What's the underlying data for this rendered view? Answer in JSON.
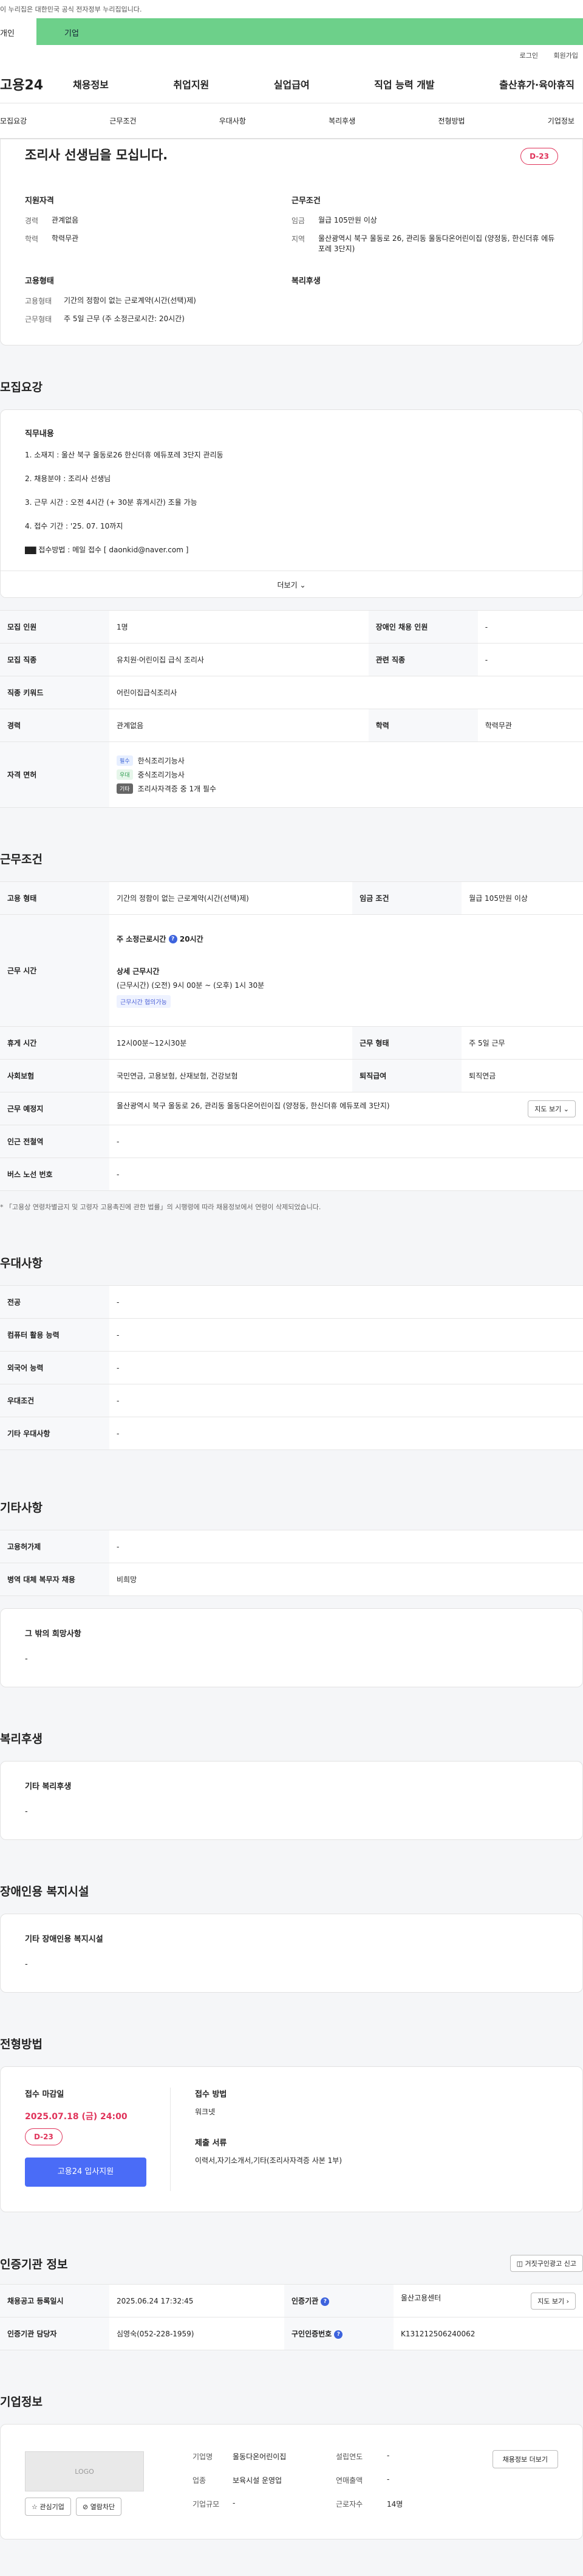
{
  "gov_notice": "이 누리집은 대한민국 공식 전자정부 누리집입니다.",
  "tabs": {
    "person": "개인",
    "company": "기업"
  },
  "util": {
    "login": "로그인",
    "join": "회원가입"
  },
  "logo": "고용24",
  "gnb": [
    "채용정보",
    "취업지원",
    "실업급여",
    "직업 능력 개발",
    "출산휴가·육아휴직"
  ],
  "anchor_nav": [
    "모집요강",
    "근무조건",
    "우대사항",
    "복리후생",
    "전형방법",
    "기업정보"
  ],
  "headline": {
    "title": "조리사 선생님을 모십니다.",
    "dday": "D-23",
    "qual_title": "지원자격",
    "qual": [
      {
        "k": "경력",
        "v": "관계없음"
      },
      {
        "k": "학력",
        "v": "학력무관"
      }
    ],
    "cond_title": "근무조건",
    "cond": [
      {
        "k": "임금",
        "v": "월급 105만원 이상"
      },
      {
        "k": "지역",
        "v": "울산광역시 북구 울동로 26, 관리동 울동다온어린이집 (양정동, 한신더휴 에듀포레 3단지)"
      }
    ],
    "employ_title": "고용형태",
    "employ": [
      {
        "k": "고용형태",
        "v": "기간의 정함이 없는 근로계약(시간(선택)제)"
      },
      {
        "k": "근무형태",
        "v": "주 5일 근무 (주 소정근로시간: 20시간)"
      }
    ],
    "welfare_title": "복리후생"
  },
  "recruit": {
    "section": "모집요강",
    "duty_title": "직무내용",
    "duty_lines": [
      "1. 소재지 : 울산 북구 울동로26 한신더휴 에듀포레 3단지 관리동",
      "2. 채용분야 : 조리사 선생님",
      "3. 근무 시간 : 오전 4시간 (+ 30분 휴게시간) 조율 가능",
      "4. 접수 기간 : '25. 07. 10까지",
      "▇▇ 접수방법 : 메일 접수 [ daonkid@naver.com ]"
    ],
    "more": "더보기",
    "rows": {
      "headcount_k": "모집 인원",
      "headcount_v": "1명",
      "disabled_k": "장애인 채용 인원",
      "disabled_v": "-",
      "job_k": "모집 직종",
      "job_v": "유치원·어린이집 급식 조리사",
      "rel_job_k": "관련 직종",
      "rel_job_v": "-",
      "keyword_k": "직종 키워드",
      "keyword_v": "어린이집급식조리사",
      "career_k": "경력",
      "career_v": "관계없음",
      "edu_k": "학력",
      "edu_v": "학력무관",
      "license_k": "자격 면허",
      "licenses": [
        {
          "tag": "필수",
          "name": "한식조리기능사"
        },
        {
          "tag": "우대",
          "name": "중식조리기능사"
        },
        {
          "tag": "기타",
          "name": "조리사자격증 중 1개 필수"
        }
      ]
    }
  },
  "work": {
    "section": "근무조건",
    "employ_k": "고용 형태",
    "employ_v": "기간의 정함이 없는 근로계약(시간(선택)제)",
    "wage_k": "임금 조건",
    "wage_v": "월급 105만원 이상",
    "time_k": "근무 시간",
    "weekly_label": "주 소정근로시간",
    "weekly_v": "20시간",
    "detail_label": "상세 근무시간",
    "detail_v": "(근무시간) (오전) 9시 00분 ~ (오후) 1시 30분",
    "consult_tag": "근무시간 협의가능",
    "break_k": "휴게 시간",
    "break_v": "12시00분~12시30분",
    "form_k": "근무 형태",
    "form_v": "주 5일 근무",
    "insurance_k": "사회보험",
    "insurance_v": "국민연금, 고용보험, 산재보험, 건강보험",
    "retire_k": "퇴직급여",
    "retire_v": "퇴직연금",
    "place_k": "근무 예정지",
    "place_v": "울산광역시 북구 울동로 26, 관리동 울동다온어린이집 (양정동, 한신더휴 에듀포레 3단지)",
    "map_btn": "지도 보기",
    "station_k": "인근 전철역",
    "station_v": "-",
    "bus_k": "버스 노선 번호",
    "bus_v": "-",
    "note": "* 「고용상 연령차별금지 및 고령자 고용촉진에 관한 법률」의 시행령에 따라 채용정보에서 연령이 삭제되었습니다."
  },
  "pref": {
    "section": "우대사항",
    "rows": [
      {
        "k": "전공",
        "v": "-"
      },
      {
        "k": "컴퓨터 활용 능력",
        "v": "-"
      },
      {
        "k": "외국어 능력",
        "v": "-"
      },
      {
        "k": "우대조건",
        "v": "-"
      },
      {
        "k": "기타 우대사항",
        "v": "-"
      }
    ]
  },
  "etc": {
    "section": "기타사항",
    "rows": [
      {
        "k": "고용허가제",
        "v": "-"
      },
      {
        "k": "병역 대체 복무자 채용",
        "v": "비희망"
      }
    ],
    "wish_label": "그 밖의 희망사항",
    "wish_v": "-"
  },
  "welfare": {
    "section": "복리후생",
    "label": "기타 복리후생",
    "v": "-"
  },
  "disabled_fac": {
    "section": "장애인용 복지시설",
    "label": "기타 장애인용 복지시설",
    "v": "-"
  },
  "process": {
    "section": "전형방법",
    "deadline_label": "접수 마감일",
    "deadline": "2025.07.18 (금) 24:00",
    "dday": "D-23",
    "apply_btn": "고용24 입사지원",
    "method_label": "접수 방법",
    "method_v": "워크넷",
    "docs_label": "제출 서류",
    "docs_v": "이력서,자기소개서,기타(조리사자격증 사본 1부)"
  },
  "cert_org": {
    "section": "인증기관 정보",
    "report_btn": "거짓구인광고 신고",
    "reg_k": "채용공고 등록일시",
    "reg_v": "2025.06.24 17:32:45",
    "org_k": "인증기관",
    "org_v": "울산고용센터",
    "map_btn": "지도 보기",
    "manager_k": "인증기관 담당자",
    "manager_v": "심영숙(052-228-1959)",
    "ident_k": "구인인증번호",
    "ident_v": "K131212506240062"
  },
  "company": {
    "section": "기업정보",
    "logo_text": "LOGO",
    "fav_btn": "관심기업",
    "block_btn": "열람차단",
    "name_k": "기업명",
    "name_v": "울동다온어린이집",
    "year_k": "설립연도",
    "year_v": "-",
    "ind_k": "업종",
    "ind_v": "보육시설 운영업",
    "sales_k": "연매출액",
    "sales_v": "-",
    "size_k": "기업규모",
    "size_v": "-",
    "emp_k": "근로자수",
    "emp_v": "14명",
    "hire_btn": "채용정보 더보기"
  }
}
